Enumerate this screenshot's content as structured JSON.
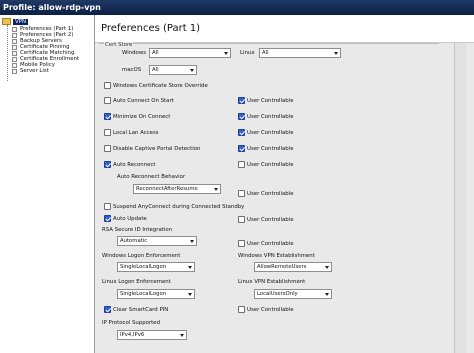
{
  "header": {
    "profile_title": "Profile:  allow-rdp-vpn"
  },
  "tree": {
    "root": "VPN",
    "items": [
      "Preferences (Part 1)",
      "Preferences (Part 2)",
      "Backup Servers",
      "Certificate Pinning",
      "Certificate Matching",
      "Certificate Enrollment",
      "Mobile Policy",
      "Server List"
    ]
  },
  "panel": {
    "title": "Preferences (Part 1)",
    "cert_store_group": "Cert Store",
    "windows_label": "Windows",
    "windows_value": "All",
    "linux_label": "Linux",
    "linux_value": "All",
    "macos_label": "macOS",
    "macos_value": "All",
    "override_label": "Windows Certificate Store Override",
    "rows": [
      {
        "label": "Auto Connect On Start",
        "checked": false,
        "uc_label": "User Controllable",
        "uc_checked": true
      },
      {
        "label": "Minimize On Connect",
        "checked": true,
        "uc_label": "User Controllable",
        "uc_checked": true
      },
      {
        "label": "Local Lan Access",
        "checked": false,
        "uc_label": "User Controllable",
        "uc_checked": true
      },
      {
        "label": "Disable Captive Portal Detection",
        "checked": false,
        "uc_label": "User Controllable",
        "uc_checked": true
      },
      {
        "label": "Auto Reconnect",
        "checked": true,
        "uc_label": "User Controllable",
        "uc_checked": false
      }
    ],
    "auto_reconnect_behavior_label": "Auto Reconnect Behavior",
    "auto_reconnect_behavior_value": "ReconnectAfterResume",
    "auto_reconnect_uc_label": "User Controllable",
    "suspend_label": "Suspend AnyConnect during Connected Standby",
    "auto_update_label": "Auto Update",
    "auto_update_uc_label": "User Controllable",
    "rsa_label": "RSA Secure ID Integration",
    "rsa_value": "Automatic",
    "rsa_uc_label": "User Controllable",
    "win_logon_label": "Windows Logon Enforcement",
    "win_logon_value": "SingleLocalLogon",
    "win_vpn_label": "Windows VPN Establishment",
    "win_vpn_value": "AllowRemoteUsers",
    "linux_logon_label": "Linux Logon Enforcement",
    "linux_logon_value": "SingleLocalLogon",
    "linux_vpn_label": "Linux VPN Establishment",
    "linux_vpn_value": "LocalUsersOnly",
    "clear_pin_label": "Clear SmartCard PIN",
    "clear_pin_uc_label": "User Controllable",
    "ip_protocol_label": "IP Protocol Supported",
    "ip_protocol_value": "IPv4,IPv6"
  }
}
